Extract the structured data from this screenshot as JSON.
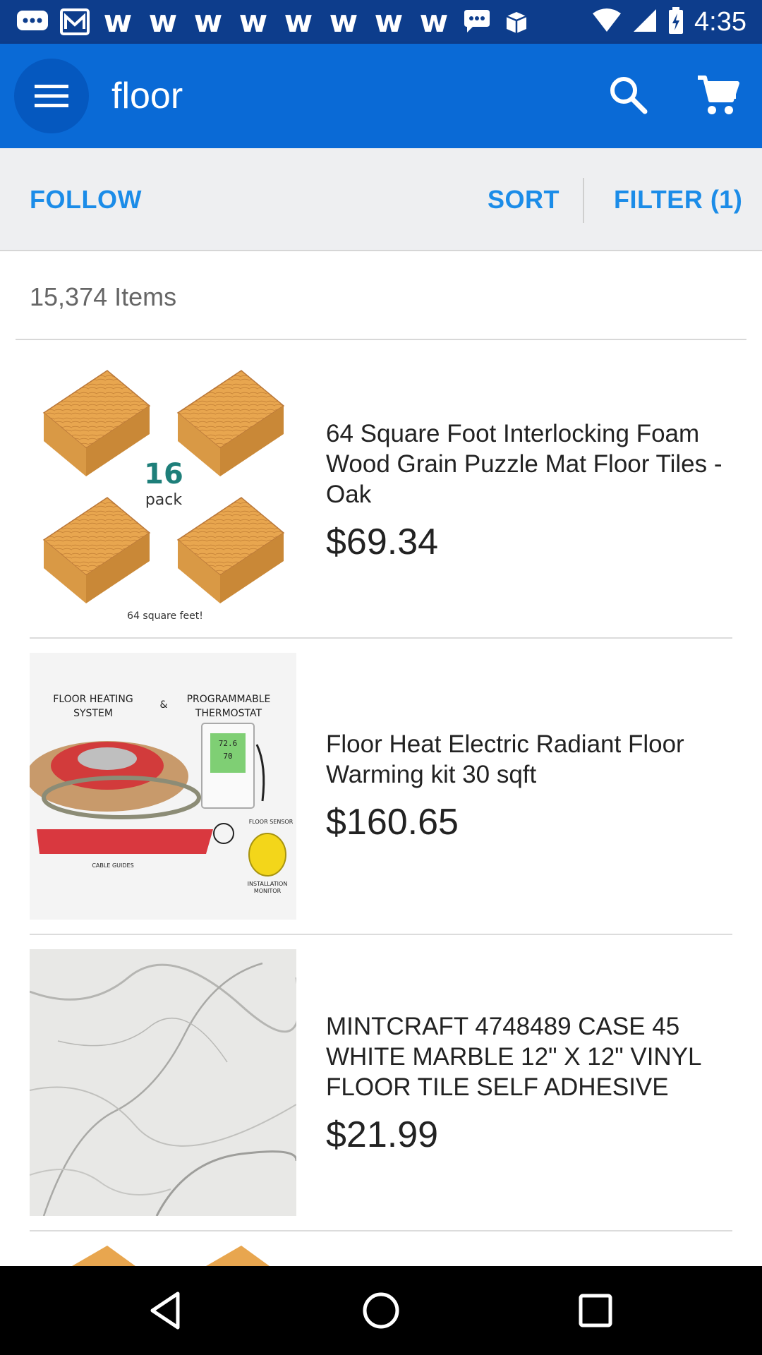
{
  "status_bar": {
    "time": "4:35",
    "notification_icons": [
      "message-icon",
      "mail-icon",
      "w-icon",
      "w-icon",
      "w-icon",
      "w-icon",
      "w-icon",
      "w-icon",
      "w-icon",
      "w-icon",
      "chat-icon",
      "box-icon"
    ],
    "w_glyph": "w"
  },
  "app_bar": {
    "query": "floor",
    "color": "#0a6ad6"
  },
  "actions": {
    "follow": "FOLLOW",
    "sort": "SORT",
    "filter": "FILTER (1)",
    "accent": "#1b8ce8"
  },
  "results": {
    "count_label": "15,374 Items",
    "items": [
      {
        "title": "64 Square Foot Interlocking Foam Wood Grain Puzzle Mat Floor Tiles - Oak",
        "price": "$69.34",
        "image": {
          "badge_number": "16",
          "badge_word": "pack",
          "caption": "64 square feet!"
        }
      },
      {
        "title": "Floor Heat Electric Radiant Floor Warming kit 30 sqft",
        "price": "$160.65",
        "image": {
          "left_label_1": "FLOOR HEATING",
          "left_label_2": "SYSTEM",
          "amp": "&",
          "right_label_1": "PROGRAMMABLE",
          "right_label_2": "THERMOSTAT",
          "sensor": "FLOOR SENSOR",
          "guides": "CABLE GUIDES",
          "monitor_1": "INSTALLATION",
          "monitor_2": "MONITOR",
          "readout_1": "72.6",
          "readout_2": "70"
        }
      },
      {
        "title": "MINTCRAFT 4748489 CASE 45 WHITE MARBLE 12\" X 12\" VINYL FLOOR TILE SELF ADHESIVE",
        "price": "$21.99",
        "image": {}
      }
    ]
  },
  "nav_bar": {
    "buttons": [
      "back-icon",
      "home-icon",
      "recents-icon"
    ]
  }
}
